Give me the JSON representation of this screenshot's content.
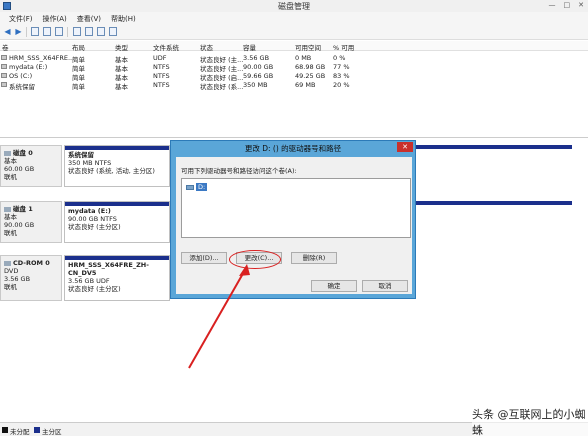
{
  "window": {
    "title": "磁盘管理",
    "controls": [
      "—",
      "□",
      "✕"
    ]
  },
  "menu": [
    "文件(F)",
    "操作(A)",
    "查看(V)",
    "帮助(H)"
  ],
  "volume_table": {
    "headers": [
      "卷",
      "布局",
      "类型",
      "文件系统",
      "状态",
      "容量",
      "可用空间",
      "% 可用"
    ],
    "rows": [
      [
        "HRM_SSS_X64FRE...",
        "简单",
        "基本",
        "UDF",
        "状态良好 (主...",
        "3.56 GB",
        "0 MB",
        "0 %"
      ],
      [
        "mydata (E:)",
        "简单",
        "基本",
        "NTFS",
        "状态良好 (主...",
        "90.00 GB",
        "68.98 GB",
        "77 %"
      ],
      [
        "OS (C:)",
        "简单",
        "基本",
        "NTFS",
        "状态良好 (启...",
        "59.66 GB",
        "49.25 GB",
        "83 %"
      ],
      [
        "系统保留",
        "简单",
        "基本",
        "NTFS",
        "状态良好 (系...",
        "350 MB",
        "69 MB",
        "20 %"
      ]
    ]
  },
  "disks": [
    {
      "name": "磁盘 0",
      "type": "基本",
      "size": "60.00 GB",
      "status": "联机",
      "part_name": "系统保留",
      "part_size": "350 MB NTFS",
      "part_status": "状态良好 (系统, 活动, 主分区)"
    },
    {
      "name": "磁盘 1",
      "type": "基本",
      "size": "90.00 GB",
      "status": "联机",
      "part_name": "mydata (E:)",
      "part_size": "90.00 GB NTFS",
      "part_status": "状态良好 (主分区)"
    },
    {
      "name": "CD-ROM 0",
      "type": "DVD",
      "size": "3.56 GB",
      "status": "联机",
      "part_name": "HRM_SSS_X64FRE_ZH-CN_DV5",
      "part_size": "3.56 GB UDF",
      "part_status": "状态良好 (主分区)"
    }
  ],
  "legend": {
    "unallocated": "未分配",
    "primary": "主分区",
    "colors": {
      "unallocated": "#111111",
      "primary": "#1b2f8c"
    }
  },
  "dialog": {
    "title": "更改 D: () 的驱动器号和路径",
    "close": "✕",
    "prompt": "可用下列驱动器号和路径访问这个卷(A):",
    "items": [
      "D:"
    ],
    "add": "添加(D)...",
    "change": "更改(C)...",
    "remove": "删除(R)",
    "ok": "确定",
    "cancel": "取消"
  },
  "watermark": "头条 @互联网上的小蜘蛛"
}
